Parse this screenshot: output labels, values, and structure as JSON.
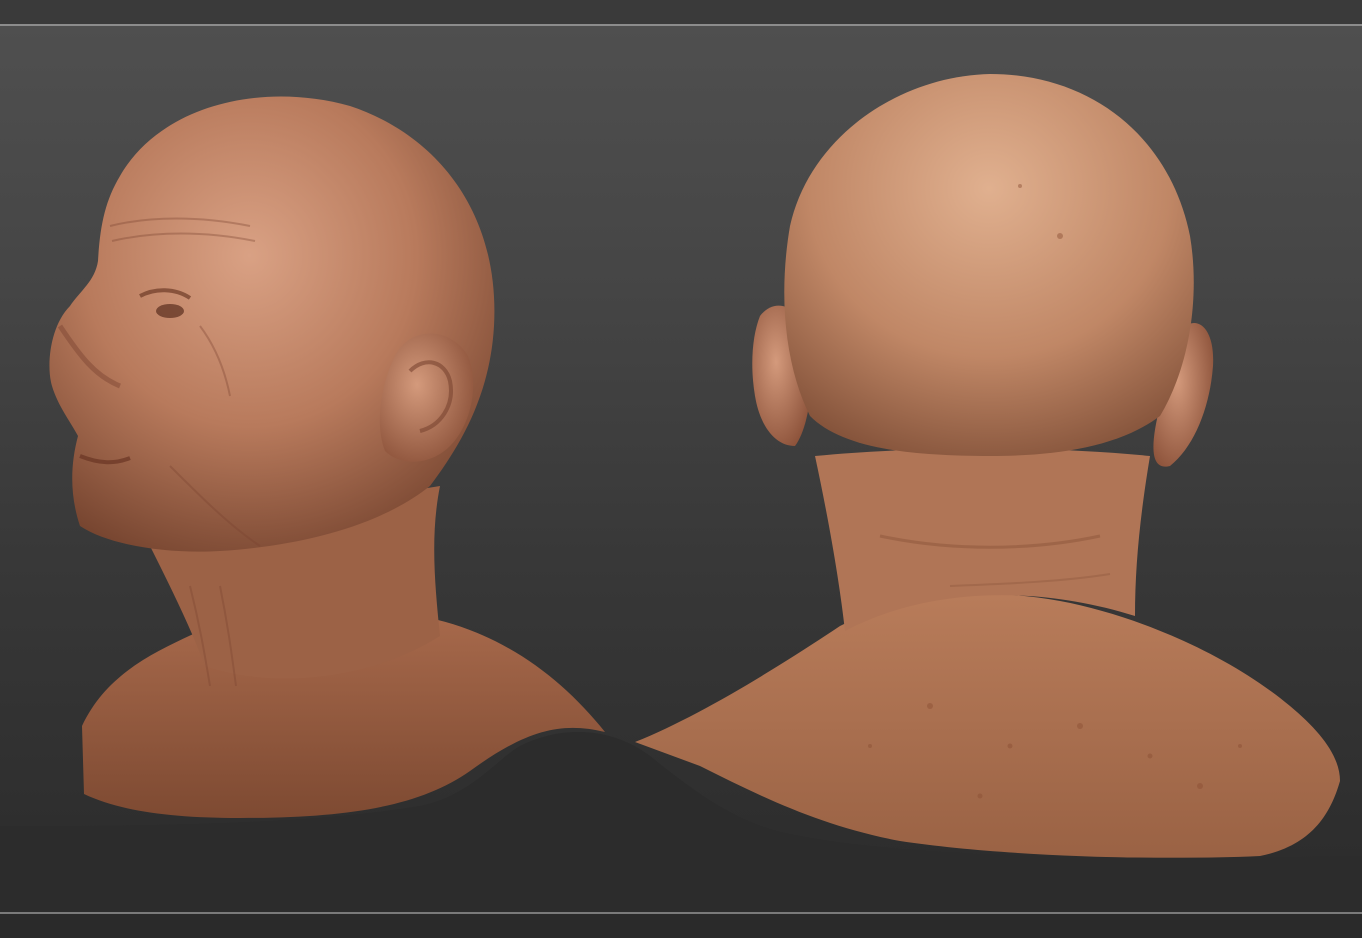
{
  "app": {
    "title": ""
  },
  "viewport": {
    "background_top": "#4f4f4f",
    "background_bottom": "#2b2b2b"
  },
  "models": [
    {
      "id": "head-side-view",
      "skin_base": "#b87a5c",
      "skin_highlight": "#d9a184",
      "skin_shadow": "#6e3e2a"
    },
    {
      "id": "head-back-view",
      "skin_base": "#c08766",
      "skin_highlight": "#e0b08f",
      "skin_shadow": "#7a4a33"
    }
  ],
  "ground": {
    "color": "#2c2c2c"
  }
}
